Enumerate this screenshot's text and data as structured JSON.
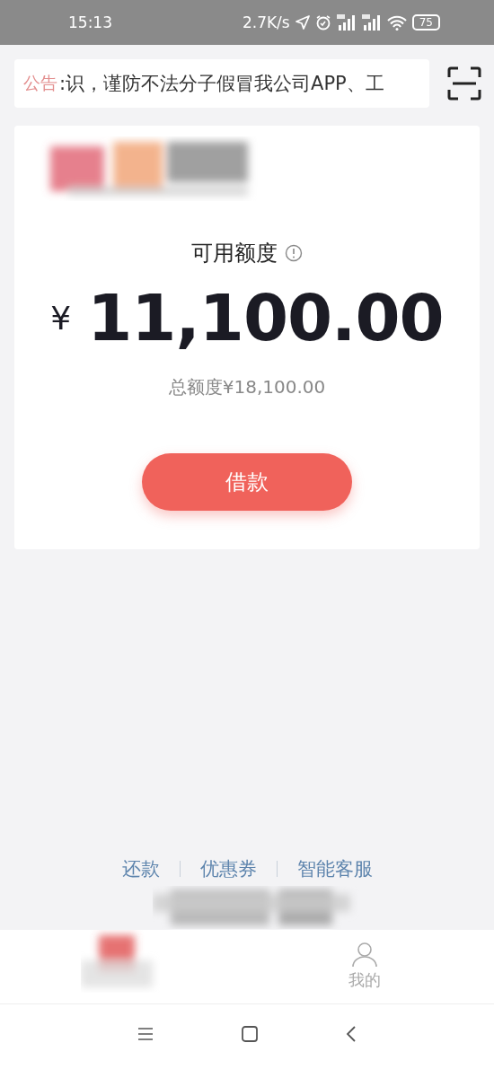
{
  "status_bar": {
    "time": "15:13",
    "network_speed": "2.7K/s",
    "battery": "75"
  },
  "announcement": {
    "label": "公告",
    "text": ":识，谨防不法分子假冒我公司APP、工"
  },
  "credit": {
    "title": "可用额度",
    "currency": "¥",
    "available": "11,100.00",
    "total_limit": "总额度¥18,100.00",
    "borrow_button": "借款"
  },
  "links": [
    "还款",
    "优惠券",
    "智能客服"
  ],
  "tab_bar": [
    {
      "label": "我的",
      "selected": false
    }
  ]
}
